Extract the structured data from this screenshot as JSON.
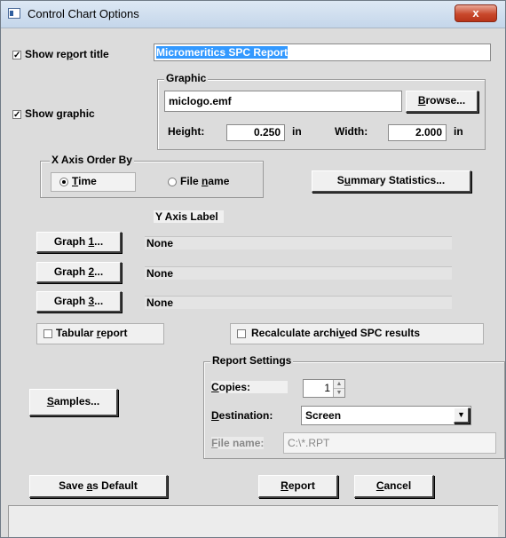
{
  "window": {
    "title": "Control Chart Options",
    "close_label": "x"
  },
  "report_title": {
    "checked": true,
    "label_pre": "Show re",
    "label_u": "p",
    "label_post": "ort title",
    "value": "Micromeritics SPC Report"
  },
  "graphic": {
    "checked": true,
    "label_pre": "Show ",
    "label_u": "g",
    "label_post": "raphic",
    "group_title": "Graphic",
    "file": "miclogo.emf",
    "browse_u": "B",
    "browse_post": "rowse...",
    "height_label": "Height:",
    "height_value": "0.250",
    "height_unit": "in",
    "width_label": "Width:",
    "width_value": "2.000",
    "width_unit": "in"
  },
  "x_axis": {
    "group_title": "X Axis Order By",
    "time_u": "T",
    "time_post": "ime",
    "file_pre": "File ",
    "file_u": "n",
    "file_post": "ame",
    "selected": "Time"
  },
  "summary_button": {
    "pre": "S",
    "u": "u",
    "post": "mmary Statistics..."
  },
  "y_axis_label_header": "Y Axis Label",
  "graphs": [
    {
      "pre": "Graph ",
      "u": "1",
      "post": "...",
      "label": "None"
    },
    {
      "pre": "Graph ",
      "u": "2",
      "post": "...",
      "label": "None"
    },
    {
      "pre": "Graph ",
      "u": "3",
      "post": "...",
      "label": "None"
    }
  ],
  "tabular": {
    "checked": false,
    "pre": "Tabular ",
    "u": "r",
    "post": "eport"
  },
  "recalc": {
    "checked": false,
    "pre": "Recalculate archi",
    "u": "v",
    "post": "ed SPC results"
  },
  "samples_button": {
    "u": "S",
    "post": "amples..."
  },
  "report_settings": {
    "group_title": "Report Settings",
    "copies_u": "C",
    "copies_post": "opies:",
    "copies_value": "1",
    "destination_u": "D",
    "destination_post": "estination:",
    "destination_value": "Screen",
    "filename_u": "F",
    "filename_post": "ile name:",
    "filename_value": "C:\\*.RPT"
  },
  "footer": {
    "save_pre": "Save ",
    "save_u": "a",
    "save_post": "s Default",
    "report_u": "R",
    "report_post": "eport",
    "cancel_u": "C",
    "cancel_post": "ancel"
  },
  "colors": {
    "selection": "#3399ff",
    "titlebar": "#c4d6ea",
    "close": "#c8482c",
    "dialog": "#dcdcdc"
  }
}
